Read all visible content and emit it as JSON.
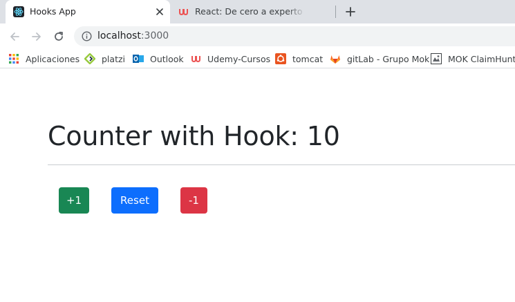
{
  "browser": {
    "tabs": [
      {
        "title": "Hooks App",
        "active": true,
        "favicon": "react-icon"
      },
      {
        "title": "React: De cero a experto ( Hooks",
        "active": false,
        "favicon": "udemy-icon"
      }
    ],
    "address": {
      "host": "localhost",
      "port": ":3000"
    },
    "bookmarks": [
      {
        "label": "Aplicaciones",
        "icon": "apps-grid-icon"
      },
      {
        "label": "platzi",
        "icon": "platzi-icon"
      },
      {
        "label": "Outlook",
        "icon": "outlook-icon"
      },
      {
        "label": "Udemy-Cursos",
        "icon": "udemy-icon"
      },
      {
        "label": "tomcat",
        "icon": "tomcat-icon"
      },
      {
        "label": "gitLab - Grupo Mok",
        "icon": "gitlab-icon"
      },
      {
        "label": "MOK ClaimHunting",
        "icon": "mok-icon"
      }
    ]
  },
  "page": {
    "title": "Counter with Hook: 10",
    "buttons": {
      "increment": "+1",
      "reset": "Reset",
      "decrement": "-1"
    }
  },
  "colors": {
    "success": "#198754",
    "primary": "#0d6efd",
    "danger": "#dc3545",
    "tabstrip": "#dee1e6"
  }
}
